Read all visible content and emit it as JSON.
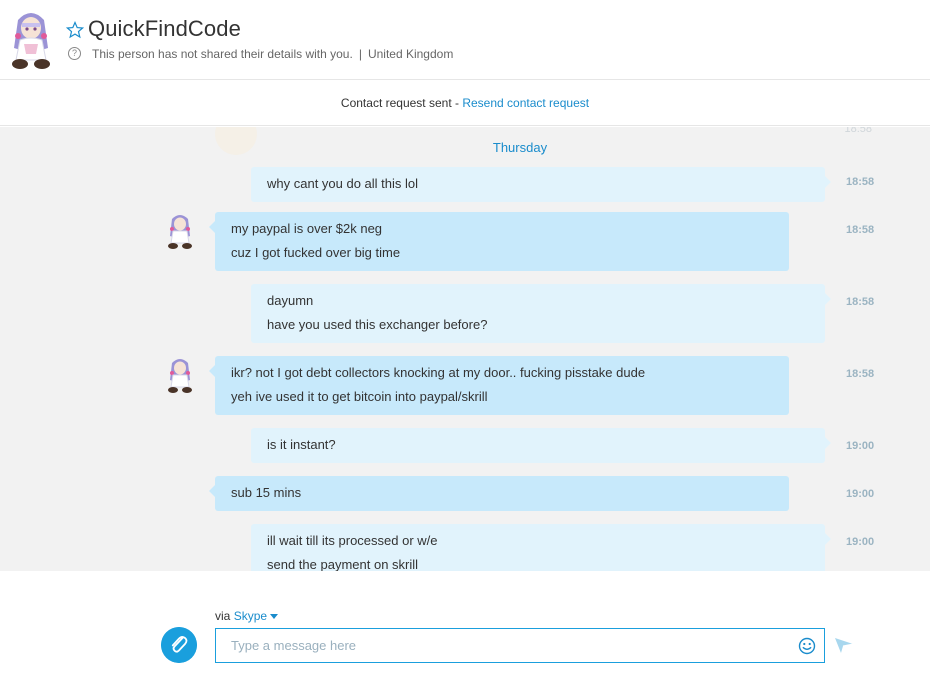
{
  "header": {
    "contact_name": "QuickFindCode",
    "status_text": "This person has not shared their details with you.",
    "separator": "|",
    "location": "United Kingdom"
  },
  "request_bar": {
    "text": "Contact request sent - ",
    "link": "Resend contact request"
  },
  "chat": {
    "day_label": "Thursday",
    "messages": [
      {
        "direction": "out",
        "lines": [
          "why cant you do all this lol"
        ],
        "time": "18:58"
      },
      {
        "direction": "in",
        "lines": [
          "my paypal is over $2k neg",
          "cuz I got fucked over big time"
        ],
        "time": "18:58"
      },
      {
        "direction": "out",
        "lines": [
          "dayumn",
          "have you used this exchanger before?"
        ],
        "time": "18:58"
      },
      {
        "direction": "in",
        "lines": [
          "ikr? not I got debt collectors knocking at my door.. fucking pisstake dude",
          "yeh ive used it to get bitcoin into paypal/skrill"
        ],
        "time": "18:58"
      },
      {
        "direction": "out",
        "lines": [
          "is it instant?"
        ],
        "time": "19:00"
      },
      {
        "direction": "in",
        "lines": [
          "sub 15 mins"
        ],
        "time": "19:00"
      },
      {
        "direction": "out",
        "lines": [
          "ill wait till its processed or w/e",
          "send the payment on skrill"
        ],
        "time": "19:00"
      }
    ]
  },
  "composer": {
    "via_label": "via",
    "service": "Skype",
    "placeholder": "Type a message here"
  },
  "icons": {
    "favorite": "star-outline-icon",
    "info": "question-circle-icon",
    "attach": "paperclip-icon",
    "emoji": "smiley-icon",
    "send": "send-arrow-icon",
    "service_dropdown": "caret-down-icon"
  },
  "colors": {
    "accent": "#1a8ccc",
    "bubble_outgoing": "#e1f3fc",
    "bubble_incoming": "#c7e9fb",
    "chat_background": "#f2f2f2",
    "attach_button": "#1a9fdd"
  }
}
